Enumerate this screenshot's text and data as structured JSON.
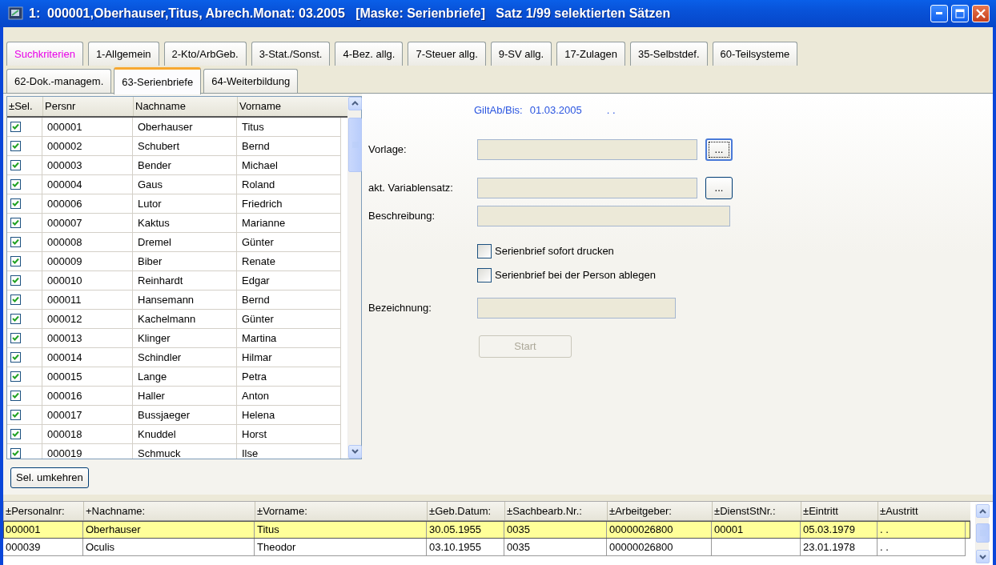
{
  "window": {
    "title": "1:  000001,Oberhauser,Titus, Abrech.Monat: 03.2005   [Maske: Serienbriefe]   Satz 1/99 selektierten Sätzen"
  },
  "tab_rows": [
    [
      {
        "label": "Suchkriterien",
        "selected": false,
        "kind": "search"
      },
      {
        "label": "1-Allgemein",
        "selected": false
      },
      {
        "label": "2-Kto/ArbGeb.",
        "selected": false
      },
      {
        "label": "3-Stat./Sonst.",
        "selected": false
      },
      {
        "label": "4-Bez. allg.",
        "selected": false
      },
      {
        "label": "7-Steuer allg.",
        "selected": false
      },
      {
        "label": "9-SV allg.",
        "selected": false
      },
      {
        "label": "17-Zulagen",
        "selected": false
      },
      {
        "label": "35-Selbstdef.",
        "selected": false
      },
      {
        "label": "60-Teilsysteme",
        "selected": false
      }
    ],
    [
      {
        "label": "62-Dok.-managem.",
        "selected": false
      },
      {
        "label": "63-Serienbriefe",
        "selected": true
      },
      {
        "label": "64-Weiterbildung",
        "selected": false
      }
    ]
  ],
  "person_grid": {
    "columns": [
      "±Sel.",
      "Persnr",
      "Nachname",
      "Vorname"
    ],
    "rows": [
      {
        "checked": true,
        "persnr": "000001",
        "nachname": "Oberhauser",
        "vorname": "Titus"
      },
      {
        "checked": true,
        "persnr": "000002",
        "nachname": "Schubert",
        "vorname": "Bernd"
      },
      {
        "checked": true,
        "persnr": "000003",
        "nachname": "Bender",
        "vorname": "Michael"
      },
      {
        "checked": true,
        "persnr": "000004",
        "nachname": "Gaus",
        "vorname": "Roland"
      },
      {
        "checked": true,
        "persnr": "000006",
        "nachname": "Lutor",
        "vorname": "Friedrich"
      },
      {
        "checked": true,
        "persnr": "000007",
        "nachname": "Kaktus",
        "vorname": "Marianne"
      },
      {
        "checked": true,
        "persnr": "000008",
        "nachname": "Dremel",
        "vorname": "Günter"
      },
      {
        "checked": true,
        "persnr": "000009",
        "nachname": "Biber",
        "vorname": "Renate"
      },
      {
        "checked": true,
        "persnr": "000010",
        "nachname": "Reinhardt",
        "vorname": "Edgar"
      },
      {
        "checked": true,
        "persnr": "000011",
        "nachname": "Hansemann",
        "vorname": "Bernd"
      },
      {
        "checked": true,
        "persnr": "000012",
        "nachname": "Kachelmann",
        "vorname": "Günter"
      },
      {
        "checked": true,
        "persnr": "000013",
        "nachname": "Klinger",
        "vorname": "Martina"
      },
      {
        "checked": true,
        "persnr": "000014",
        "nachname": "Schindler",
        "vorname": "Hilmar"
      },
      {
        "checked": true,
        "persnr": "000015",
        "nachname": "Lange",
        "vorname": "Petra"
      },
      {
        "checked": true,
        "persnr": "000016",
        "nachname": "Haller",
        "vorname": "Anton"
      },
      {
        "checked": true,
        "persnr": "000017",
        "nachname": "Bussjaeger",
        "vorname": "Helena"
      },
      {
        "checked": true,
        "persnr": "000018",
        "nachname": "Knuddel",
        "vorname": "Horst"
      },
      {
        "checked": true,
        "persnr": "000019",
        "nachname": "Schmuck",
        "vorname": "Ilse"
      }
    ],
    "invert_button": "Sel. umkehren"
  },
  "form": {
    "validity": {
      "label": "GiltAb/Bis:",
      "from": "01.03.2005",
      "to": ". ."
    },
    "fields": [
      {
        "label": "Vorlage:",
        "kind": "browse",
        "button": "...",
        "focused": true
      },
      {
        "label": "akt. Variablensatz:",
        "kind": "browse",
        "button": "...",
        "focused": false
      },
      {
        "label": "Beschreibung:",
        "kind": "text"
      }
    ],
    "options": [
      {
        "label": "Serienbrief sofort drucken",
        "checked": false
      },
      {
        "label": "Serienbrief bei der Person ablegen",
        "checked": false
      }
    ],
    "name_field": {
      "label": "Bezeichnung:"
    },
    "start_button": {
      "label": "Start",
      "disabled": true
    }
  },
  "record_table": {
    "columns": [
      "±Personalnr:",
      "+Nachname:",
      "±Vorname:",
      "±Geb.Datum:",
      "±Sachbearb.Nr.:",
      "±Arbeitgeber:",
      "±DienstStNr.:",
      "±Eintritt",
      "±Austritt"
    ],
    "rows": [
      {
        "selected": true,
        "cells": [
          "000001",
          "Oberhauser",
          "Titus",
          "30.05.1955",
          "0035",
          "00000026800",
          "00001",
          "05.03.1979",
          ". ."
        ]
      },
      {
        "selected": false,
        "cells": [
          "000039",
          "Oculis",
          "Theodor",
          "03.10.1955",
          "0035",
          "00000026800",
          "",
          "23.01.1978",
          ". ."
        ]
      }
    ]
  }
}
